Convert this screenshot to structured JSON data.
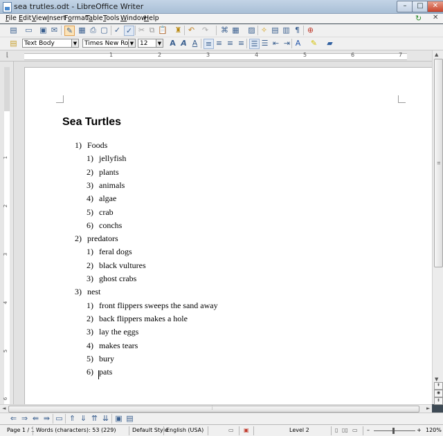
{
  "window": {
    "title": "sea trutles.odt - LibreOffice Writer",
    "minimize_glyph": "–",
    "maximize_glyph": "□",
    "close_glyph": "✕"
  },
  "menubar": {
    "items": [
      {
        "accel": "F",
        "rest": "ile"
      },
      {
        "accel": "E",
        "rest": "dit"
      },
      {
        "accel": "V",
        "rest": "iew"
      },
      {
        "accel": "I",
        "rest": "nsert"
      },
      {
        "pre": "F",
        "accel": "o",
        "rest": "rmat"
      },
      {
        "pre": "T",
        "accel": "a",
        "rest": "ble"
      },
      {
        "accel": "T",
        "rest": "ools"
      },
      {
        "accel": "W",
        "rest": "indow"
      },
      {
        "accel": "H",
        "rest": "elp"
      }
    ]
  },
  "formatting": {
    "paragraph_style": "Text Body",
    "font_name": "Times New Roman",
    "font_size": "12"
  },
  "ruler": {
    "numbers": [
      "1",
      "2",
      "3",
      "4",
      "5",
      "6",
      "7"
    ],
    "vertical_numbers": [
      "1",
      "2",
      "3",
      "4",
      "5",
      "6"
    ]
  },
  "document": {
    "title": "Sea Turtles",
    "lists": [
      {
        "num": "1)",
        "text": "Foods",
        "items": [
          {
            "num": "1)",
            "text": "jellyfish"
          },
          {
            "num": "2)",
            "text": "plants"
          },
          {
            "num": "3)",
            "text": "animals"
          },
          {
            "num": "4)",
            "text": "algae"
          },
          {
            "num": "5)",
            "text": "crab"
          },
          {
            "num": "6)",
            "text": "conchs"
          }
        ]
      },
      {
        "num": "2)",
        "text": "predators",
        "items": [
          {
            "num": "1)",
            "text": "feral dogs"
          },
          {
            "num": "2)",
            "text": "black vultures"
          },
          {
            "num": "3)",
            "text": "ghost crabs"
          }
        ]
      },
      {
        "num": "3)",
        "text": "nest",
        "items": [
          {
            "num": "1)",
            "text": "front flippers sweeps the sand away"
          },
          {
            "num": "2)",
            "text": "back flippers makes a hole"
          },
          {
            "num": "3)",
            "text": "lay the eggs"
          },
          {
            "num": "4)",
            "text": "makes tears"
          },
          {
            "num": "5)",
            "text": "bury"
          },
          {
            "num": "6)",
            "text": "pats"
          }
        ]
      }
    ]
  },
  "statusbar": {
    "page": "Page 1 / 1",
    "words": "Words (characters): 53 (229)",
    "page_style": "Default Style",
    "language": "English (USA)",
    "outline_level": "Level 2",
    "zoom_minus": "–",
    "zoom_plus": "+",
    "zoom": "120%"
  },
  "icons": {
    "sync": "↻",
    "doc_close": "✕",
    "scroll_up": "▲",
    "scroll_down": "▼",
    "scroll_left": "◄",
    "scroll_right": "►",
    "scroll_grip": "≡",
    "hscroll_grip": "⋮",
    "nav_prev": "⇞",
    "nav_target": "◉",
    "nav_next": "⇟"
  },
  "colors": {
    "accent": "#3a5f8f",
    "close_button": "#c8432b",
    "page": "#ffffff",
    "workspace": "#e2e2e2"
  }
}
